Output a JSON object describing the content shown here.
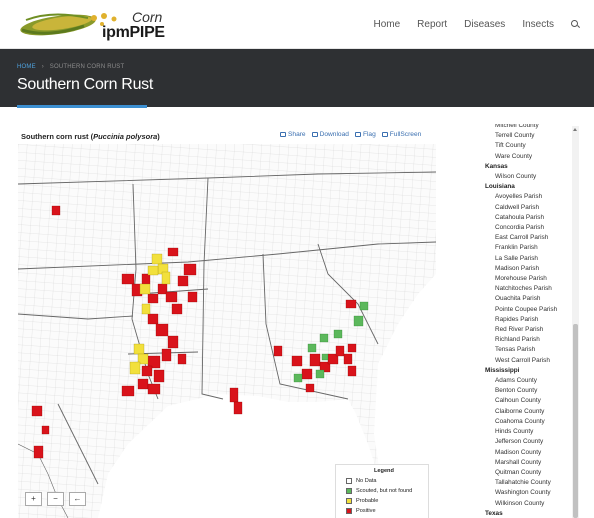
{
  "site": {
    "logo_corn": "Corn",
    "logo_ipm": "ipm",
    "logo_pipe": "PIPE"
  },
  "nav": {
    "items": [
      "Home",
      "Report",
      "Diseases",
      "Insects"
    ],
    "search_icon": "search-icon"
  },
  "banner": {
    "breadcrumb_home": "HOME",
    "breadcrumb_sep": "›",
    "breadcrumb_current": "SOUTHERN CORN RUST",
    "title": "Southern Corn Rust",
    "background": "#2e3033",
    "accent": "#3c8fd1"
  },
  "map": {
    "heading_prefix": "Southern corn rust (",
    "heading_species": "Puccinia polysora",
    "heading_suffix": ")",
    "tools": [
      "Share",
      "Download",
      "Flag",
      "FullScreen"
    ],
    "zoom_in": "+",
    "zoom_out": "−",
    "back": "←",
    "legend": {
      "title": "Legend",
      "items": [
        {
          "label": "No Data",
          "color": "#ffffff"
        },
        {
          "label": "Scouted, but not found",
          "color": "#5cb85c"
        },
        {
          "label": "Probable",
          "color": "#f2e03c"
        },
        {
          "label": "Positive",
          "color": "#d9131b"
        }
      ]
    }
  },
  "county_list": [
    {
      "type": "county",
      "name": "Mitchell County"
    },
    {
      "type": "county",
      "name": "Terrell County"
    },
    {
      "type": "county",
      "name": "Tift County"
    },
    {
      "type": "county",
      "name": "Ware County"
    },
    {
      "type": "state",
      "name": "Kansas"
    },
    {
      "type": "county",
      "name": "Wilson County"
    },
    {
      "type": "state",
      "name": "Louisiana"
    },
    {
      "type": "county",
      "name": "Avoyelles Parish"
    },
    {
      "type": "county",
      "name": "Caldwell Parish"
    },
    {
      "type": "county",
      "name": "Catahoula Parish"
    },
    {
      "type": "county",
      "name": "Concordia Parish"
    },
    {
      "type": "county",
      "name": "East Carroll Parish"
    },
    {
      "type": "county",
      "name": "Franklin Parish"
    },
    {
      "type": "county",
      "name": "La Salle Parish"
    },
    {
      "type": "county",
      "name": "Madison Parish"
    },
    {
      "type": "county",
      "name": "Morehouse Parish"
    },
    {
      "type": "county",
      "name": "Natchitoches Parish"
    },
    {
      "type": "county",
      "name": "Ouachita Parish"
    },
    {
      "type": "county",
      "name": "Pointe Coupee Parish"
    },
    {
      "type": "county",
      "name": "Rapides Parish"
    },
    {
      "type": "county",
      "name": "Red River Parish"
    },
    {
      "type": "county",
      "name": "Richland Parish"
    },
    {
      "type": "county",
      "name": "Tensas Parish"
    },
    {
      "type": "county",
      "name": "West Carroll Parish"
    },
    {
      "type": "state",
      "name": "Mississippi"
    },
    {
      "type": "county",
      "name": "Adams County"
    },
    {
      "type": "county",
      "name": "Benton County"
    },
    {
      "type": "county",
      "name": "Calhoun County"
    },
    {
      "type": "county",
      "name": "Claiborne County"
    },
    {
      "type": "county",
      "name": "Coahoma County"
    },
    {
      "type": "county",
      "name": "Hinds County"
    },
    {
      "type": "county",
      "name": "Jefferson County"
    },
    {
      "type": "county",
      "name": "Madison County"
    },
    {
      "type": "county",
      "name": "Marshall County"
    },
    {
      "type": "county",
      "name": "Quitman County"
    },
    {
      "type": "county",
      "name": "Tallahatchie County"
    },
    {
      "type": "county",
      "name": "Washington County"
    },
    {
      "type": "county",
      "name": "Wilkinson County"
    },
    {
      "type": "state",
      "name": "Texas"
    }
  ]
}
